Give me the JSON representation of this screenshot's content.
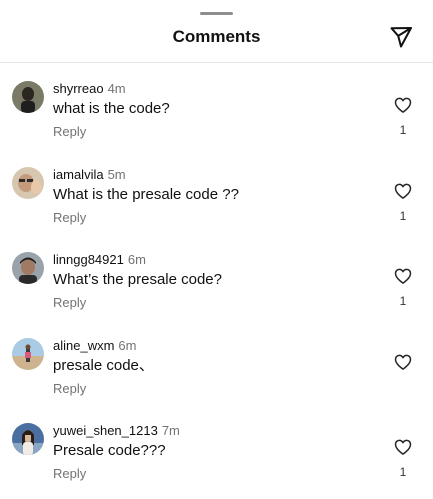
{
  "header": {
    "title": "Comments"
  },
  "icons": {
    "send": "send-paper-plane-icon",
    "like": "heart-outline-icon"
  },
  "comments": [
    {
      "username": "shyrreao",
      "time": "4m",
      "text": "what is the code?",
      "reply_label": "Reply",
      "likes": "1",
      "avatar_colors": [
        "#6b6b5a",
        "#2b2b2b"
      ]
    },
    {
      "username": "iamalvila",
      "time": "5m",
      "text": "What is the presale code ??",
      "reply_label": "Reply",
      "likes": "1",
      "avatar_colors": [
        "#c9b39b",
        "#5a4a3a"
      ]
    },
    {
      "username": "linngg84921",
      "time": "6m",
      "text": "What’s the presale code?",
      "reply_label": "Reply",
      "likes": "1",
      "avatar_colors": [
        "#8f9aa3",
        "#2f2f2f"
      ]
    },
    {
      "username": "aline_wxm",
      "time": "6m",
      "text": "presale code、",
      "reply_label": "Reply",
      "likes": "",
      "avatar_colors": [
        "#a9cbe3",
        "#c2a27a"
      ]
    },
    {
      "username": "yuwei_shen_1213",
      "time": "7m",
      "text": "Presale code???",
      "reply_label": "Reply",
      "likes": "1",
      "avatar_colors": [
        "#4a6fa0",
        "#e0d6c8"
      ]
    }
  ]
}
